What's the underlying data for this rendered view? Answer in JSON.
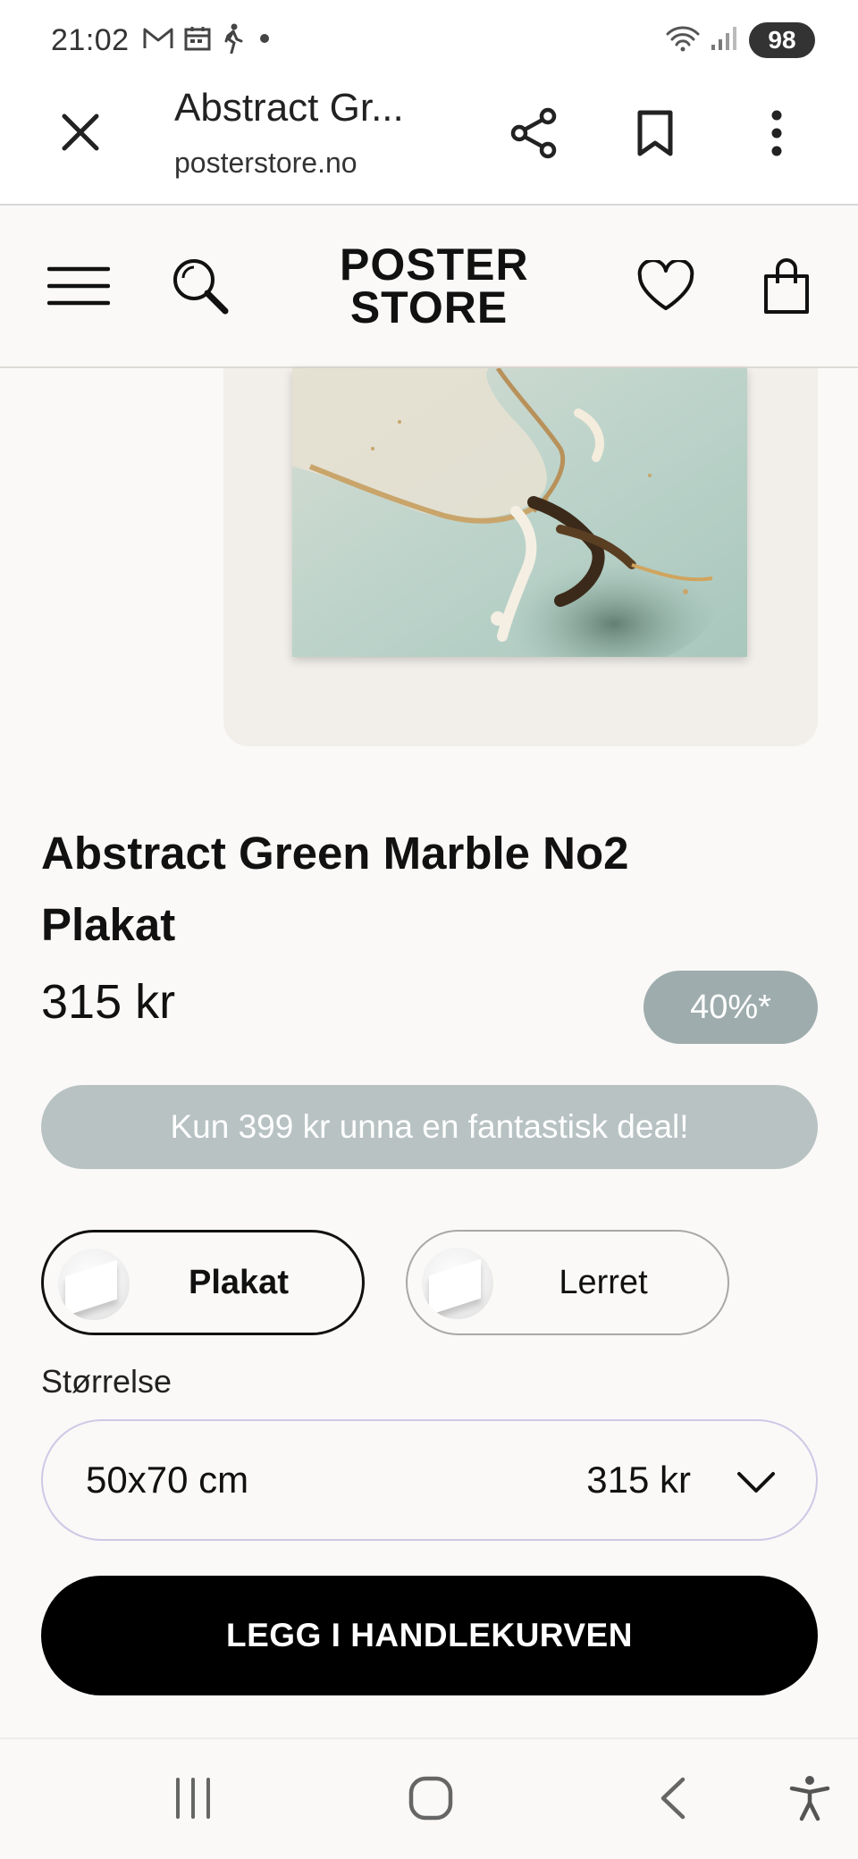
{
  "status_bar": {
    "time": "21:02",
    "left_icons": [
      "gmail-icon",
      "calendar-icon",
      "walking-icon",
      "dot-icon"
    ],
    "right_icons": [
      "wifi-icon",
      "signal-icon"
    ],
    "battery": "98"
  },
  "tab_bar": {
    "title": "Abstract Gr...",
    "url": "posterstore.no",
    "icons": [
      "close-icon",
      "share-icon",
      "bookmark-icon",
      "more-icon"
    ]
  },
  "site_header": {
    "logo_line1": "POSTER",
    "logo_line2": "STORE",
    "icons": [
      "menu-icon",
      "search-icon",
      "heart-icon",
      "shopping-bag-icon"
    ]
  },
  "product": {
    "title": "Abstract Green Marble No2 Plakat",
    "price": "315 kr",
    "discount": "40%*",
    "deal_banner": "Kun 399 kr unna en fantastisk deal!",
    "variants": [
      {
        "label": "Plakat",
        "selected": true
      },
      {
        "label": "Lerret",
        "selected": false
      }
    ],
    "size_label": "Størrelse",
    "size_value": "50x70 cm",
    "size_price": "315 kr",
    "add_to_cart": "LEGG I HANDLEKURVEN"
  },
  "nav_bar": {
    "icons": [
      "recent-apps-icon",
      "home-icon",
      "back-icon",
      "accessibility-icon"
    ]
  },
  "colors": {
    "discount_badge": "#9eacad",
    "deal_banner": "#b8c2c3",
    "cta": "#000000",
    "page_bg": "#faf9f7"
  }
}
